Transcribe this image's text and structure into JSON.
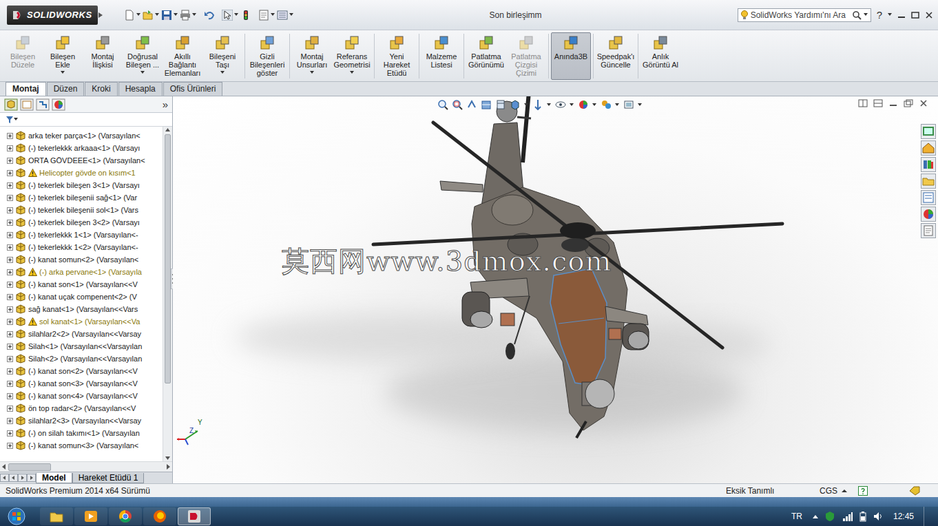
{
  "window": {
    "app": "SOLIDWORKS",
    "title": "Son birleşimm"
  },
  "search": {
    "placeholder": "SolidWorks Yardımı'nı Ara"
  },
  "help": "?",
  "ribbon": [
    {
      "label": "Bileşen Düzele",
      "disabled": true,
      "selected": false,
      "dropdown": false
    },
    {
      "label": "Bileşen Ekle",
      "disabled": false,
      "selected": false,
      "dropdown": true
    },
    {
      "label": "Montaj İlişkisi",
      "disabled": false,
      "selected": false,
      "dropdown": false
    },
    {
      "label": "Doğrusal Bileşen ...",
      "disabled": false,
      "selected": false,
      "dropdown": true
    },
    {
      "label": "Akıllı Bağlantı Elemanları",
      "disabled": false,
      "selected": false,
      "dropdown": false
    },
    {
      "label": "Bileşeni Taşı",
      "disabled": false,
      "selected": false,
      "dropdown": true
    },
    {
      "label": "Gizli Bileşenleri göster",
      "disabled": false,
      "selected": false,
      "dropdown": false
    },
    {
      "label": "Montaj Unsurları",
      "disabled": false,
      "selected": false,
      "dropdown": true
    },
    {
      "label": "Referans Geometrisi",
      "disabled": false,
      "selected": false,
      "dropdown": true
    },
    {
      "label": "Yeni Hareket Etüdü",
      "disabled": false,
      "selected": false,
      "dropdown": false
    },
    {
      "label": "Malzeme Listesi",
      "disabled": false,
      "selected": false,
      "dropdown": false
    },
    {
      "label": "Patlatma Görünümü",
      "disabled": false,
      "selected": false,
      "dropdown": false
    },
    {
      "label": "Patlatma Çizgisi Çizimi",
      "disabled": true,
      "selected": false,
      "dropdown": false
    },
    {
      "label": "Anında3B",
      "disabled": false,
      "selected": true,
      "dropdown": false
    },
    {
      "label": "Speedpak'ı Güncelle",
      "disabled": false,
      "selected": false,
      "dropdown": false
    },
    {
      "label": "Anlık Görüntü Al",
      "disabled": false,
      "selected": false,
      "dropdown": false
    }
  ],
  "tabs": [
    {
      "label": "Montaj",
      "selected": true
    },
    {
      "label": "Düzen",
      "selected": false
    },
    {
      "label": "Kroki",
      "selected": false
    },
    {
      "label": "Hesapla",
      "selected": false
    },
    {
      "label": "Ofis Ürünleri",
      "selected": false
    }
  ],
  "panel": {
    "more": "»"
  },
  "tree": {
    "items": [
      {
        "label": "arka teker parça<1> (Varsayılan<",
        "warning": false
      },
      {
        "label": "(-) tekerlekkk arkaaa<1> (Varsayı",
        "warning": false
      },
      {
        "label": "ORTA GÖVDEEE<1> (Varsayılan<",
        "warning": false
      },
      {
        "label": "Helicopter gövde on kısım<1",
        "warning": true
      },
      {
        "label": "(-) tekerlek bileşen 3<1> (Varsayı",
        "warning": false
      },
      {
        "label": "(-) tekerlek bileşenii sağ<1> (Var",
        "warning": false
      },
      {
        "label": "(-) tekerlek bileşenii sol<1> (Vars",
        "warning": false
      },
      {
        "label": "(-) tekerlek bileşen 3<2> (Varsayı",
        "warning": false
      },
      {
        "label": "(-) tekerlekkk 1<1> (Varsayılan<-",
        "warning": false
      },
      {
        "label": "(-) tekerlekkk 1<2> (Varsayılan<-",
        "warning": false
      },
      {
        "label": "(-) kanat somun<2> (Varsayılan<",
        "warning": false
      },
      {
        "label": "(-) arka pervane<1> (Varsayıla",
        "warning": true
      },
      {
        "label": "(-) kanat son<1> (Varsayılan<<V",
        "warning": false
      },
      {
        "label": "(-) kanat uçak compenent<2> (V",
        "warning": false
      },
      {
        "label": "sağ kanat<1> (Varsayılan<<Vars",
        "warning": false
      },
      {
        "label": "sol kanat<1> (Varsayılan<<Va",
        "warning": true
      },
      {
        "label": "silahlar2<2> (Varsayılan<<Varsay",
        "warning": false
      },
      {
        "label": "Silah<1> (Varsayılan<<Varsayılan",
        "warning": false
      },
      {
        "label": "Silah<2> (Varsayılan<<Varsayılan",
        "warning": false
      },
      {
        "label": "(-) kanat son<2> (Varsayılan<<V",
        "warning": false
      },
      {
        "label": "(-) kanat son<3> (Varsayılan<<V",
        "warning": false
      },
      {
        "label": "(-) kanat son<4> (Varsayılan<<V",
        "warning": false
      },
      {
        "label": "ön top radar<2> (Varsayılan<<V",
        "warning": false
      },
      {
        "label": "silahlar2<3> (Varsayılan<<Varsay",
        "warning": false
      },
      {
        "label": "(-) on silah takımı<1> (Varsayılan",
        "warning": false
      },
      {
        "label": "(-) kanat somun<3> (Varsayılan<",
        "warning": false
      }
    ],
    "scroll": {
      "level": 0.78
    }
  },
  "bottom_tabs": [
    {
      "label": "Model",
      "selected": true
    },
    {
      "label": "Hareket Etüdü 1",
      "selected": false
    }
  ],
  "watermark": "莫西网www.3dmox.com",
  "triad": {
    "y": "Y",
    "z": "Z"
  },
  "status_bar": {
    "version": "SolidWorks Premium 2014 x64 Sürümü",
    "state": "Eksik Tanımlı",
    "units": "CGS"
  },
  "taskbar": {
    "language": "TR",
    "time": "12:45"
  }
}
